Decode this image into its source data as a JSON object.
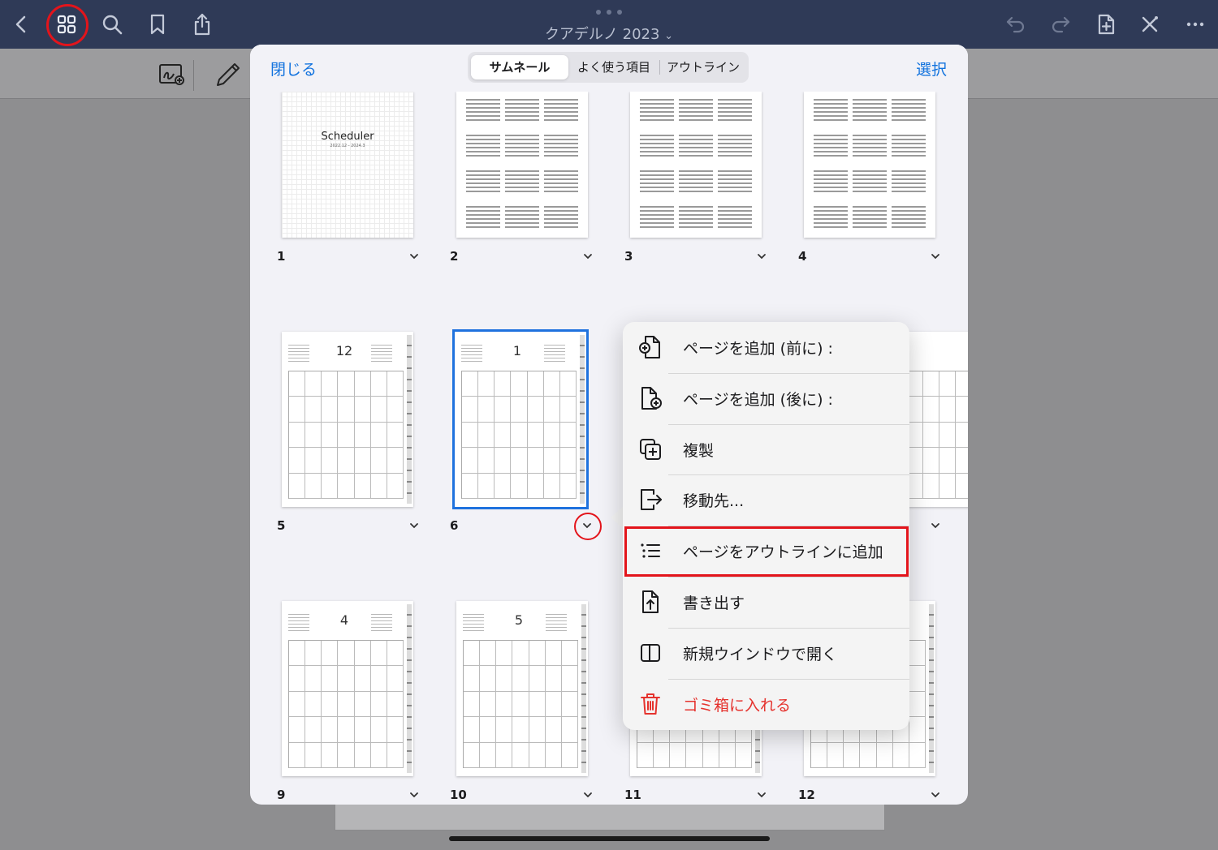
{
  "topbar": {
    "title": "クアデルノ 2023",
    "title_chevron": "chevron-down-icon",
    "left_icons": [
      "back-chevron-icon",
      "grid-icon",
      "search-icon",
      "bookmark-icon",
      "share-icon"
    ],
    "right_icons": [
      "undo-icon",
      "redo-icon",
      "add-page-icon",
      "close-tools-icon",
      "more-icon"
    ]
  },
  "subbar": {
    "icons": [
      "lasso-zoom-icon",
      "pencil-icon"
    ]
  },
  "sheet": {
    "close_label": "閉じる",
    "select_label": "選択",
    "tabs": [
      {
        "label": "サムネール",
        "selected": true
      },
      {
        "label": "よく使う項目",
        "selected": false
      },
      {
        "label": "アウトライン",
        "selected": false
      }
    ],
    "pages": [
      {
        "number": "1",
        "kind": "cover",
        "title": "Scheduler",
        "subtitle": "2022.12 - 2024.3"
      },
      {
        "number": "2",
        "kind": "year"
      },
      {
        "number": "3",
        "kind": "year"
      },
      {
        "number": "4",
        "kind": "year"
      },
      {
        "number": "5",
        "kind": "month",
        "month": "12"
      },
      {
        "number": "6",
        "kind": "month",
        "month": "1",
        "selected": true
      },
      {
        "number": "9",
        "kind": "month",
        "month": "4"
      },
      {
        "number": "10",
        "kind": "month",
        "month": "5"
      },
      {
        "number": "11",
        "kind": "month-partial"
      },
      {
        "number": "12",
        "kind": "month-partial"
      }
    ]
  },
  "menu": {
    "items": [
      {
        "label": "ページを追加 (前に) :",
        "icon": "add-page-before-icon"
      },
      {
        "label": "ページを追加 (後に) :",
        "icon": "add-page-after-icon"
      },
      {
        "label": "複製",
        "icon": "duplicate-icon"
      },
      {
        "label": "移動先...",
        "icon": "move-icon"
      },
      {
        "label": "ページをアウトラインに追加",
        "icon": "outline-list-icon"
      },
      {
        "label": "書き出す",
        "icon": "export-icon"
      },
      {
        "label": "新規ウインドウで開く",
        "icon": "new-window-icon"
      },
      {
        "label": "ゴミ箱に入れる",
        "icon": "trash-icon",
        "danger": true
      }
    ]
  },
  "colors": {
    "topbar": "#2f3a57",
    "accent": "#1273de",
    "highlight_red": "#e3141b",
    "danger": "#e5322d",
    "selection_blue": "#1f72de"
  }
}
